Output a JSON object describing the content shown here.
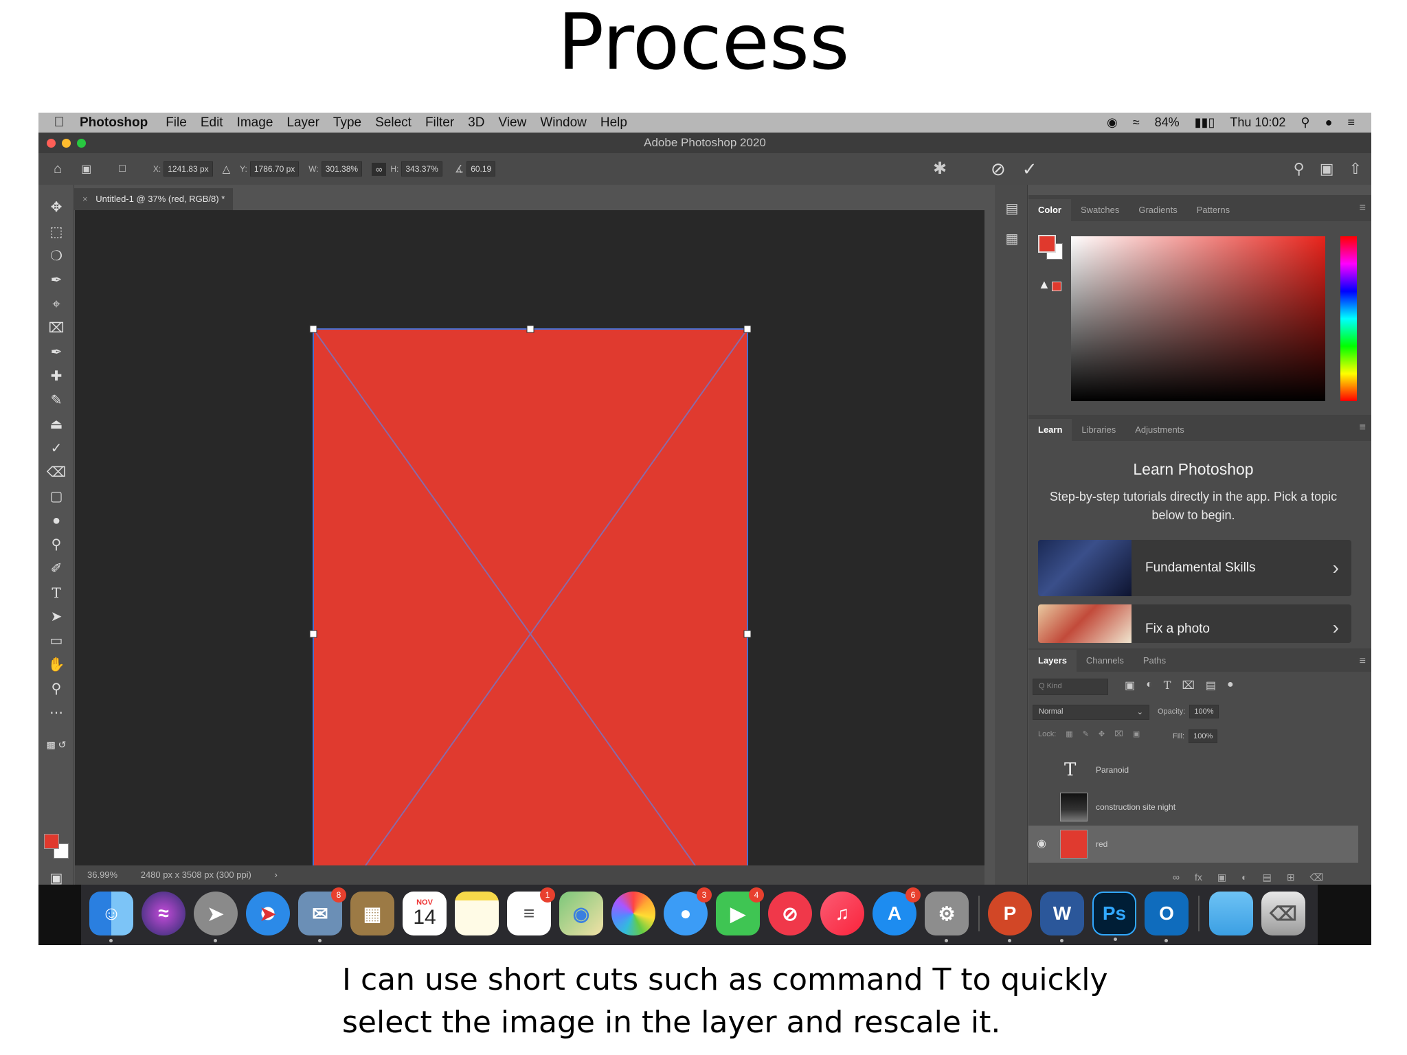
{
  "slide": {
    "title": "Process",
    "caption_lines": [
      "I can use short cuts such as command T to quickly",
      "select the image in the layer and rescale it."
    ]
  },
  "menubar": {
    "app": "Photoshop",
    "items": [
      "File",
      "Edit",
      "Image",
      "Layer",
      "Type",
      "Select",
      "Filter",
      "3D",
      "View",
      "Window",
      "Help"
    ],
    "battery": "84%",
    "clock": "Thu 10:02"
  },
  "window": {
    "title": "Adobe Photoshop 2020"
  },
  "options_bar": {
    "x_label": "X:",
    "x_value": "1241.83 px",
    "y_label": "Y:",
    "y_value": "1786.70 px",
    "w_label": "W:",
    "w_value": "301.38%",
    "h_label": "H:",
    "h_value": "343.37%",
    "angle_value": "60.19"
  },
  "document": {
    "tab_label": "Untitled-1 @ 37% (red, RGB/8) *",
    "zoom": "36.99%",
    "doc_info": "2480 px x 3508 px (300 ppi)"
  },
  "color_panel": {
    "tabs": [
      "Color",
      "Swatches",
      "Gradients",
      "Patterns"
    ],
    "foreground": "#e0392d",
    "background": "#ffffff"
  },
  "learn_panel": {
    "tabs": [
      "Learn",
      "Libraries",
      "Adjustments"
    ],
    "title": "Learn Photoshop",
    "description": "Step-by-step tutorials directly in the app. Pick a topic below to begin.",
    "cards": [
      "Fundamental Skills",
      "Fix a photo"
    ]
  },
  "layers_panel": {
    "tabs": [
      "Layers",
      "Channels",
      "Paths"
    ],
    "search_placeholder": "Q Kind",
    "blend_mode": "Normal",
    "opacity_label": "Opacity:",
    "opacity_value": "100%",
    "lock_label": "Lock:",
    "fill_label": "Fill:",
    "fill_value": "100%",
    "layers": [
      "Paranoid",
      "construction site night",
      "red"
    ]
  },
  "dock": {
    "badges": {
      "photos_preview": "8",
      "reminders": "1",
      "messages": "3",
      "facetime": "4",
      "appstore": "6"
    },
    "calendar_month": "NOV",
    "calendar_day": "14",
    "apps": [
      "Finder",
      "Siri",
      "Launchpad",
      "Safari",
      "Preview",
      "Notes Book",
      "Calendar",
      "Notes",
      "Reminders",
      "Maps",
      "Photos",
      "Messages",
      "FaceTime",
      "News",
      "Music",
      "App Store",
      "System Preferences",
      "PowerPoint",
      "Word",
      "Photoshop",
      "Outlook",
      "Folder",
      "Trash"
    ]
  },
  "colors": {
    "canvas_red": "#e03a2f",
    "ps_blue": "#31a8ff"
  }
}
